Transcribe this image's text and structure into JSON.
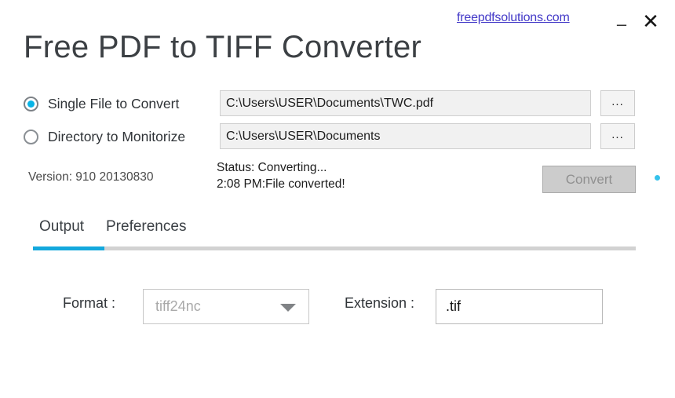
{
  "window": {
    "title": "Free PDF to TIFF Converter",
    "site_link": "freepdfsolutions.com",
    "minimize_glyph": "–",
    "close_glyph": "✕",
    "accent_color": "#14a8dd",
    "link_color": "#4339c8"
  },
  "source": {
    "single": {
      "label": "Single File to Convert",
      "selected": true,
      "path": "C:\\Users\\USER\\Documents\\TWC.pdf",
      "browse_label": "..."
    },
    "directory": {
      "label": "Directory to Monitorize",
      "selected": false,
      "path": "C:\\Users\\USER\\Documents",
      "browse_label": "..."
    }
  },
  "status": {
    "version": "Version: 910 20130830",
    "line1": "Status: Converting...",
    "line2": "2:08 PM:File converted!",
    "convert_label": "Convert",
    "convert_enabled": false,
    "busy_indicator_color": "#35c2ec"
  },
  "tabs": {
    "items": [
      {
        "label": "Output",
        "active": true
      },
      {
        "label": "Preferences",
        "active": false
      }
    ]
  },
  "output_pane": {
    "format_label": "Format :",
    "format_value": "tiff24nc",
    "format_options": [
      "tiff24nc"
    ],
    "extension_label": "Extension :",
    "extension_value": ".tif"
  }
}
